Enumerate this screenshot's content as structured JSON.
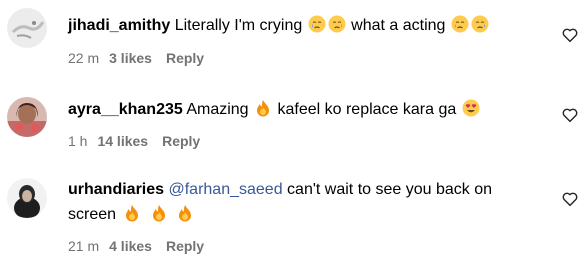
{
  "comments": [
    {
      "username": "jihadi_amithy",
      "text_1": "Literally I'm crying",
      "text_2": "what a acting",
      "time": "22 m",
      "likes": "3 likes",
      "reply": "Reply",
      "emoji": "crying-face"
    },
    {
      "username": "ayra__khan235",
      "text_1": "Amazing",
      "text_2": "kafeel ko replace kara ga",
      "time": "1 h",
      "likes": "14 likes",
      "reply": "Reply",
      "emoji_1": "fire",
      "emoji_2": "heart-eyes-face"
    },
    {
      "username": "urhandiaries",
      "mention": "@farhan_saeed",
      "text_1": "can't wait to see you back on",
      "text_2": "screen",
      "time": "21 m",
      "likes": "4 likes",
      "reply": "Reply",
      "emoji": "fire"
    }
  ],
  "colors": {
    "meta_gray": "#737373",
    "mention_blue": "#385898",
    "text": "#000000"
  }
}
